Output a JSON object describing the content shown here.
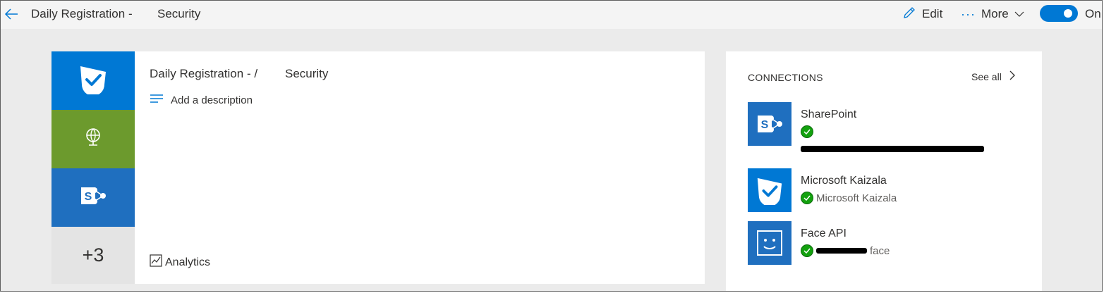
{
  "header": {
    "title": "Daily Registration -",
    "title_suffix": "Security",
    "edit_label": "Edit",
    "more_label": "More",
    "toggle_label": "On"
  },
  "flow": {
    "title": "Daily Registration - /",
    "title_suffix": "Security",
    "description_placeholder": "Add a description",
    "analytics_label": "Analytics",
    "more_connectors": "+3"
  },
  "connections": {
    "heading": "CONNECTIONS",
    "see_all": "See all",
    "items": [
      {
        "name": "SharePoint",
        "icon": "sharepoint-icon",
        "account": "",
        "status": "connected"
      },
      {
        "name": "Microsoft Kaizala",
        "icon": "kaizala-icon",
        "account": "Microsoft Kaizala",
        "status": "connected"
      },
      {
        "name": "Face API",
        "icon": "face-api-icon",
        "account": "face",
        "status": "connected"
      }
    ]
  },
  "colors": {
    "accent": "#0078d4",
    "http_tile": "#6c9a2d",
    "sharepoint_tile": "#1f6fbf",
    "status_ok": "#13a10e"
  }
}
